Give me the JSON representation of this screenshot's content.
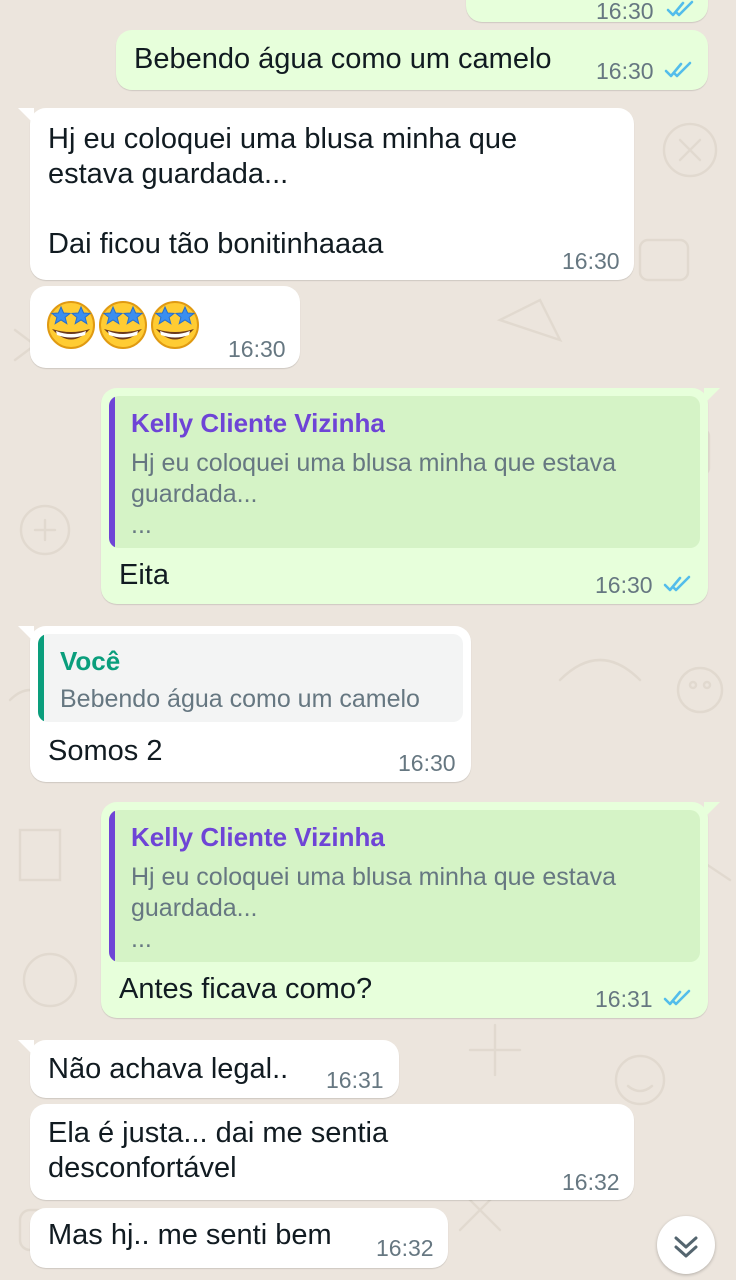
{
  "colors": {
    "wallpaper": "#ece5dd",
    "incoming_bubble": "#ffffff",
    "outgoing_bubble": "#e7ffdb",
    "quote_author_contact": "#6e44d6",
    "quote_author_self": "#0a9e7c",
    "read_ticks": "#53bdeb",
    "timestamp": "#667781"
  },
  "icons": {
    "read_receipt": "double-check-icon",
    "star_eyes": "star-struck-emoji",
    "scroll_down": "double-chevron-down-icon"
  },
  "messages": [
    {
      "direction": "out",
      "text": "Bebendo água como um camelo",
      "time": "16:30",
      "status": "read"
    },
    {
      "direction": "in",
      "text": "Hj eu coloquei uma blusa minha que\nestava guardada...\n\nDai ficou tão bonitinhaaaa",
      "time": "16:30"
    },
    {
      "direction": "in",
      "emoji_count": 3,
      "emoji": "star-struck",
      "time": "16:30"
    },
    {
      "direction": "out",
      "quote": {
        "author": "Kelly Cliente Vizinha",
        "text": "Hj eu coloquei uma blusa minha que estava\nguardada...\n..."
      },
      "text": "Eita",
      "time": "16:30",
      "status": "read"
    },
    {
      "direction": "in",
      "quote": {
        "author": "Você",
        "text": "Bebendo água como um camelo"
      },
      "text": "Somos 2",
      "time": "16:30"
    },
    {
      "direction": "out",
      "quote": {
        "author": "Kelly Cliente Vizinha",
        "text": "Hj eu coloquei uma blusa minha que estava\nguardada...\n..."
      },
      "text": "Antes ficava como?",
      "time": "16:31",
      "status": "read"
    },
    {
      "direction": "in",
      "text": "Não achava legal..",
      "time": "16:31"
    },
    {
      "direction": "in",
      "text": "Ela é justa... dai me sentia\ndesconfortável",
      "time": "16:32"
    },
    {
      "direction": "in",
      "text": "Mas hj.. me senti bem",
      "time": "16:32"
    }
  ]
}
